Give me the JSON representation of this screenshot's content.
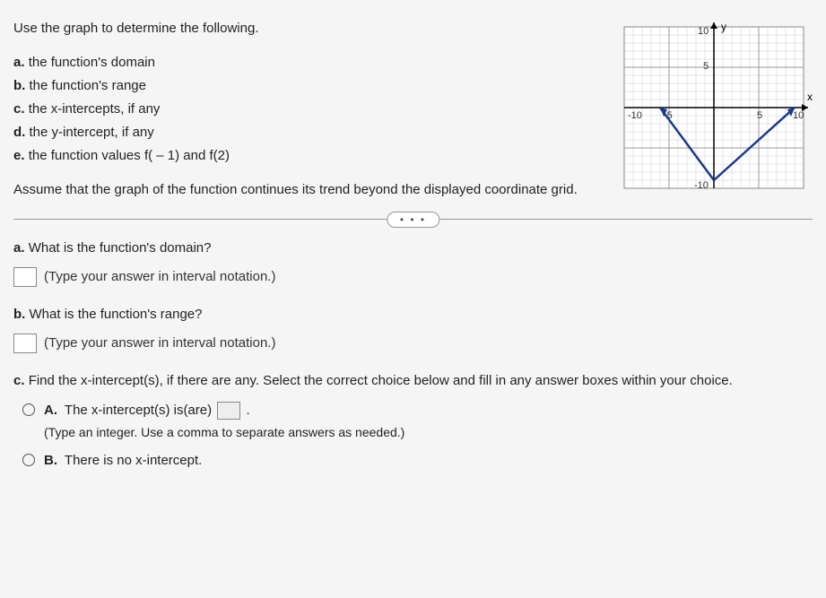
{
  "prompt": "Use the graph to determine the following.",
  "subparts": {
    "a": {
      "label": "a.",
      "text": "the function's domain"
    },
    "b": {
      "label": "b.",
      "text": "the function's range"
    },
    "c": {
      "label": "c.",
      "text": "the x-intercepts, if any"
    },
    "d": {
      "label": "d.",
      "text": "the y-intercept, if any"
    },
    "e": {
      "label": "e.",
      "text": "the function values f( – 1) and f(2)"
    }
  },
  "assumption": "Assume that the graph of the function continues its trend beyond the displayed coordinate grid.",
  "ellipsis": "• • •",
  "qa": {
    "label": "a.",
    "question": "What is the function's domain?",
    "hint": "(Type your answer in interval notation.)"
  },
  "qb": {
    "label": "b.",
    "question": "What is the function's range?",
    "hint": "(Type your answer in interval notation.)"
  },
  "qc": {
    "label": "c.",
    "question": "Find the x-intercept(s), if there are any. Select the correct choice below and fill in any answer boxes within your choice.",
    "choiceA": {
      "letter": "A.",
      "pre": "The x-intercept(s) is(are) ",
      "post": ".",
      "hint": "(Type an integer. Use a comma to separate answers as needed.)"
    },
    "choiceB": {
      "letter": "B.",
      "text": "There is no x-intercept."
    }
  },
  "graph": {
    "axis_labels": {
      "x": "x",
      "y": "y"
    },
    "ticks": {
      "neg10": "-10",
      "neg5": "-5",
      "pos5": "5",
      "pos10": "10"
    },
    "y_ticks": {
      "pos10": "10",
      "pos5": "5",
      "neg10": "-10"
    }
  },
  "chart_data": {
    "type": "line",
    "title": "",
    "xlabel": "x",
    "ylabel": "y",
    "xlim": [
      -10,
      10
    ],
    "ylim": [
      -10,
      10
    ],
    "series": [
      {
        "name": "left-ray",
        "x": [
          -6,
          0
        ],
        "y": [
          0,
          -9
        ],
        "arrow_start": true
      },
      {
        "name": "right-ray",
        "x": [
          0,
          9
        ],
        "y": [
          -9,
          0
        ],
        "arrow_end": true
      }
    ],
    "vertex": {
      "x": 0,
      "y": -9
    }
  }
}
